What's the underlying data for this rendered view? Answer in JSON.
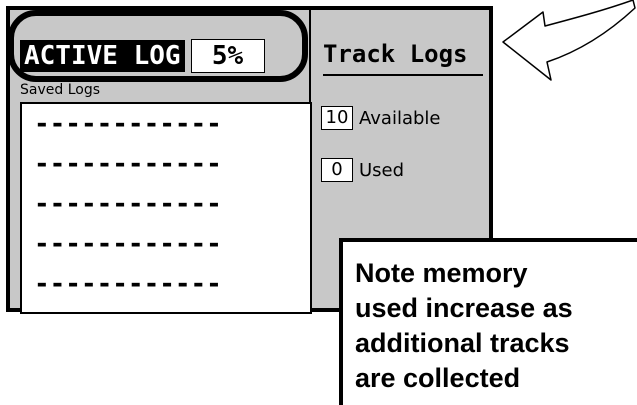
{
  "device": {
    "active_log_label": "ACTIVE LOG",
    "active_log_percent": "5%",
    "saved_logs_label": "Saved Logs",
    "saved_logs": [
      "------------",
      "------------",
      "------------",
      "------------",
      "------------"
    ],
    "track_logs_title": "Track Logs",
    "available_value": "10",
    "available_label": "Available",
    "used_value": "0",
    "used_label": "Used"
  },
  "note": {
    "lines": [
      "Note memory",
      "used increase as",
      "additional tracks",
      "are collected"
    ]
  }
}
